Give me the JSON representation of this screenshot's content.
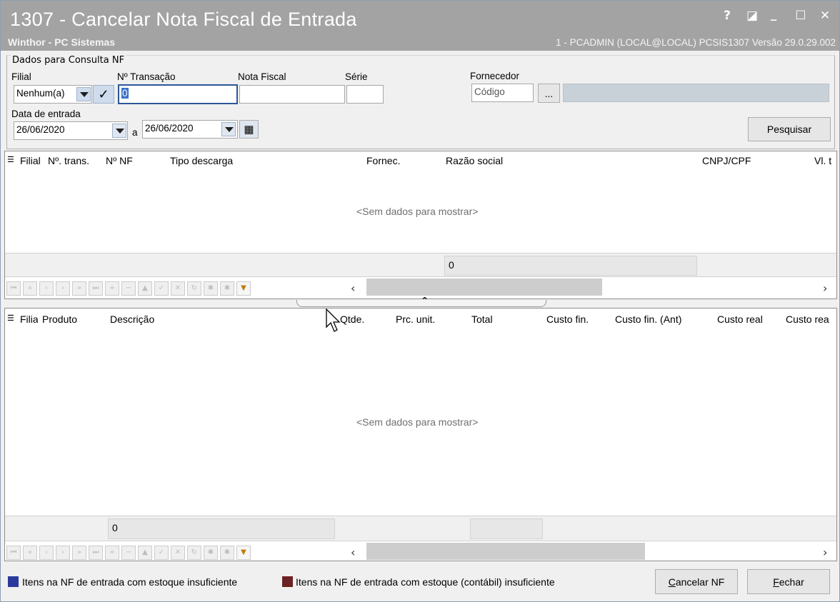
{
  "window": {
    "title": "1307 - Cancelar Nota Fiscal de  Entrada",
    "subtitle": "Winthor - PC Sistemas",
    "userinfo": "1 - PCADMIN (LOCAL@LOCAL)   PCSIS1307  Versão  29.0.29.002",
    "controls": {
      "help": "?",
      "restore": "◪",
      "minimize": "_",
      "maximize": "☐",
      "close": "✕"
    }
  },
  "filter": {
    "legend": "Dados para Consulta NF",
    "filial_label": "Filial",
    "filial_value": "Nenhum(a)",
    "transacao_label": "Nº Transação",
    "transacao_value": "0",
    "nota_label": "Nota Fiscal",
    "nota_value": "",
    "serie_label": "Série",
    "serie_value": "",
    "fornecedor_label": "Fornecedor",
    "fornecedor_placeholder": "Código",
    "fornecedor_browse": "...",
    "data_label": "Data de entrada",
    "data_de": "26/06/2020",
    "data_a_label": "a",
    "data_ate": "26/06/2020",
    "search_button": "Pesquisar"
  },
  "grid_top": {
    "columns": [
      "Filial",
      "Nº. trans.",
      "Nº NF",
      "Tipo descarga",
      "Fornec.",
      "Razão social",
      "CNPJ/CPF",
      "Vl. t"
    ],
    "empty_text": "<Sem dados para mostrar>",
    "summary": "0"
  },
  "grid_bottom": {
    "columns": [
      "Filia",
      "Produto",
      "Descrição",
      "Qtde.",
      "Prc. unit.",
      "Total",
      "Custo fin.",
      "Custo fin. (Ant)",
      "Custo real",
      "Custo rea"
    ],
    "empty_text": "<Sem dados para mostrar>",
    "summary": "0"
  },
  "legend_items": [
    {
      "color": "#2a3a9c",
      "label": "Itens na NF de entrada com estoque insuficiente"
    },
    {
      "color": "#6b2222",
      "label": "Itens na NF de entrada com estoque (contábil) insuficiente"
    }
  ],
  "actions": {
    "cancel_prefix": "C",
    "cancel_rest": "ancelar NF",
    "close_prefix": "F",
    "close_rest": "echar"
  }
}
